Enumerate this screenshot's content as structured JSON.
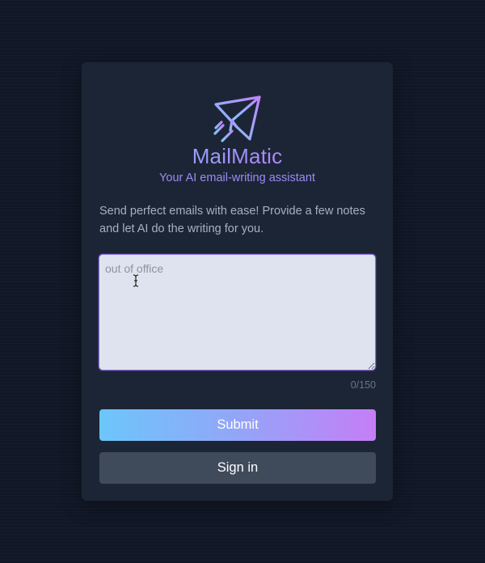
{
  "app": {
    "title": "MailMatic",
    "tagline": "Your AI email-writing assistant"
  },
  "intro_text": "Send perfect emails with ease! Provide a few notes and let AI do the writing for you.",
  "notes_field": {
    "value": "",
    "placeholder": "out of office"
  },
  "counter": "0/150",
  "buttons": {
    "submit_label": "Submit",
    "signin_label": "Sign in"
  },
  "icons": {
    "logo": "paper-plane-icon",
    "cursor": "text-cursor-icon"
  },
  "colors": {
    "page_background": "#111726",
    "card_background": "#1c2535",
    "gradient_start": "#6cc6fb",
    "gradient_end": "#c57ef7",
    "tagline": "#9a8cf5",
    "signin_background": "#3f4a5b",
    "field_border": "#8b6fe0"
  }
}
